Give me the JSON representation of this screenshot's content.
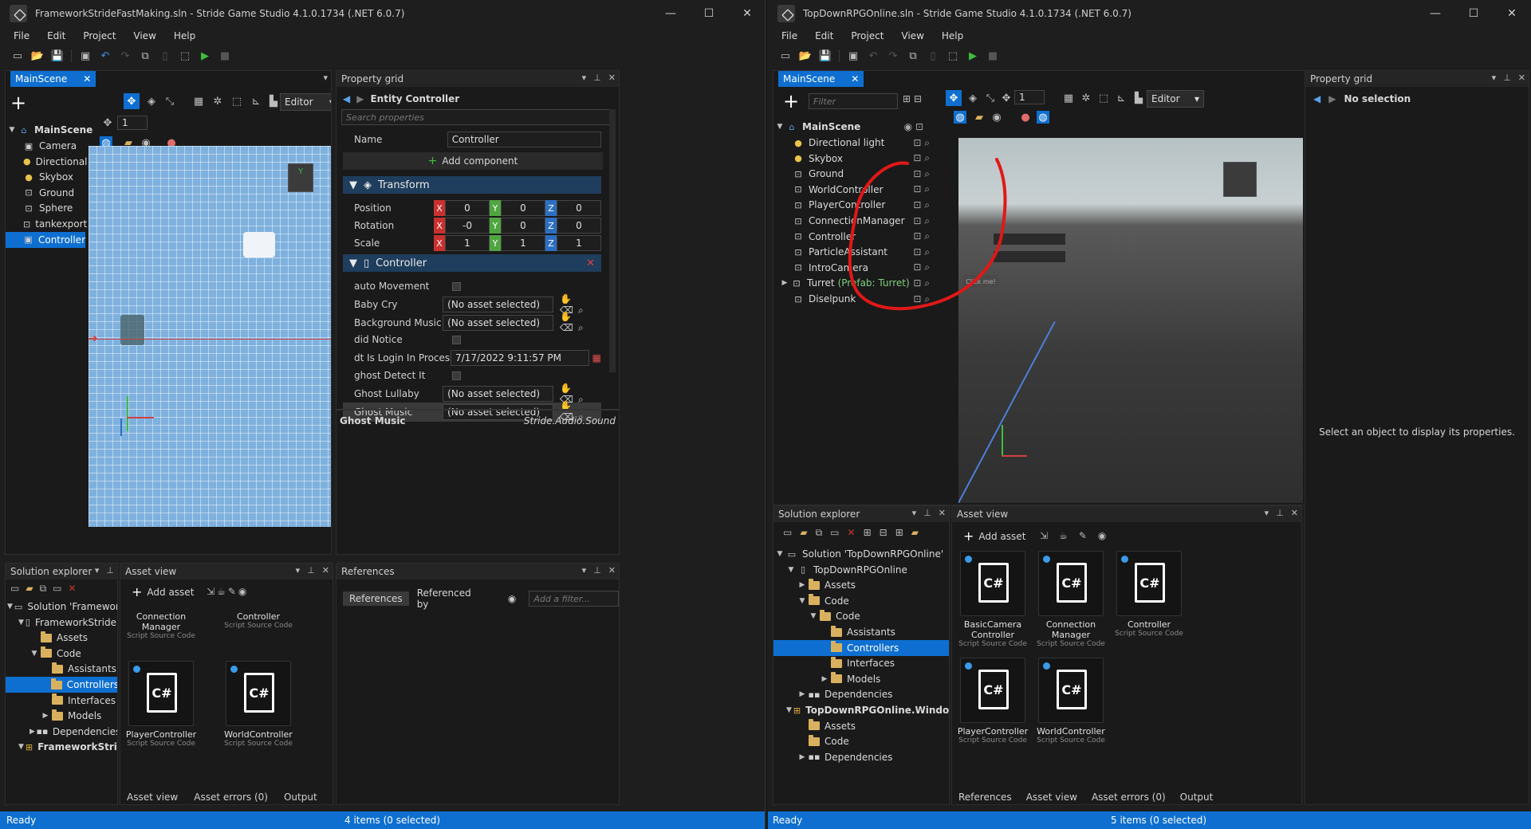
{
  "left": {
    "title": "FrameworkStrideFastMaking.sln - Stride Game Studio 4.1.0.1734 (.NET 6.0.7)",
    "menu": [
      "File",
      "Edit",
      "Project",
      "View",
      "Help"
    ],
    "scene_tab": "MainScene",
    "scene_editor_mode": "Editor",
    "snap_value": "1",
    "scene_tree": {
      "root": "MainScene",
      "items": [
        "Camera",
        "Directional light",
        "Skybox",
        "Ground",
        "Sphere",
        "tankexport",
        "Controller"
      ]
    },
    "property_grid": {
      "title": "Property grid",
      "entity_label": "Entity",
      "entity_name": "Controller",
      "search_placeholder": "Search properties",
      "name_label": "Name",
      "name_value": "Controller",
      "add_component": "Add component",
      "transform_section": "Transform",
      "position_label": "Position",
      "rotation_label": "Rotation",
      "scale_label": "Scale",
      "position": [
        "0",
        "0",
        "0"
      ],
      "rotation": [
        "-0",
        "0",
        "0"
      ],
      "scale": [
        "1",
        "1",
        "1"
      ],
      "axis_labels": [
        "X",
        "Y",
        "Z"
      ],
      "controller_section": "Controller",
      "props": [
        {
          "label": "auto Movement",
          "kind": "check"
        },
        {
          "label": "Baby Cry",
          "kind": "asset",
          "value": "(No asset selected)"
        },
        {
          "label": "Background Music",
          "kind": "asset",
          "value": "(No asset selected)"
        },
        {
          "label": "did Notice",
          "kind": "check"
        },
        {
          "label": "dt Is Login In Process",
          "kind": "date",
          "value": "7/17/2022 9:11:57 PM"
        },
        {
          "label": "ghost Detect It",
          "kind": "check"
        },
        {
          "label": "Ghost Lullaby",
          "kind": "asset",
          "value": "(No asset selected)"
        },
        {
          "label": "Ghost Music",
          "kind": "asset",
          "value": "(No asset selected)"
        }
      ],
      "footer_name": "Ghost Music",
      "footer_type": "Stride.Audio.Sound"
    },
    "solution_explorer": {
      "title": "Solution explorer",
      "items": [
        {
          "label": "Solution 'FrameworkStride",
          "indent": 0,
          "icon": "solution",
          "arrow": "▼"
        },
        {
          "label": "FrameworkStrideFas",
          "indent": 1,
          "icon": "project",
          "arrow": "▼"
        },
        {
          "label": "Assets",
          "indent": 2,
          "icon": "folder",
          "arrow": ""
        },
        {
          "label": "Code",
          "indent": 2,
          "icon": "folder",
          "arrow": "▼"
        },
        {
          "label": "Assistants",
          "indent": 3,
          "icon": "folder",
          "arrow": ""
        },
        {
          "label": "Controllers",
          "indent": 3,
          "icon": "folder",
          "arrow": "",
          "selected": true
        },
        {
          "label": "Interfaces",
          "indent": 3,
          "icon": "folder",
          "arrow": ""
        },
        {
          "label": "Models",
          "indent": 3,
          "icon": "folder",
          "arrow": "▶"
        },
        {
          "label": "Dependencies",
          "indent": 2,
          "icon": "deps",
          "arrow": "▶"
        },
        {
          "label": "FrameworkStrideI",
          "indent": 1,
          "icon": "windows",
          "arrow": "▼",
          "bold": true
        }
      ]
    },
    "asset_view": {
      "title": "Asset view",
      "add_asset": "Add asset",
      "tiles": [
        {
          "name": "Connection Manager",
          "type": "Script Source Code"
        },
        {
          "name": "Controller",
          "type": "Script Source Code"
        },
        {
          "name": "PlayerController",
          "type": "Script Source Code"
        },
        {
          "name": "WorldController",
          "type": "Script Source Code"
        }
      ],
      "bottom_tabs": [
        "Asset view",
        "Asset errors (0)",
        "Output"
      ]
    },
    "references": {
      "title": "References",
      "tab_references": "References",
      "tab_referenced_by": "Referenced by",
      "filter_placeholder": "Add a filter..."
    },
    "status_left": "Ready",
    "status_center": "4 items (0 selected)"
  },
  "right": {
    "title": "TopDownRPGOnline.sln - Stride Game Studio 4.1.0.1734 (.NET 6.0.7)",
    "menu": [
      "File",
      "Edit",
      "Project",
      "View",
      "Help"
    ],
    "scene_tab": "MainScene",
    "filter_placeholder": "Filter",
    "scene_editor_mode": "Editor",
    "snap_value": "1",
    "scene_tree": {
      "root": "MainScene",
      "items": [
        {
          "label": "Directional light",
          "icon": "light"
        },
        {
          "label": "Skybox",
          "icon": "light"
        },
        {
          "label": "Ground",
          "icon": "entity"
        },
        {
          "label": "WorldController",
          "icon": "entity"
        },
        {
          "label": "PlayerController",
          "icon": "entity"
        },
        {
          "label": "ConnectionManager",
          "icon": "entity"
        },
        {
          "label": "Controller",
          "icon": "entity"
        },
        {
          "label": "ParticleAssistant",
          "icon": "entity"
        },
        {
          "label": "IntroCamera",
          "icon": "entity"
        },
        {
          "label": "Turret",
          "icon": "entity",
          "prefab": "(Prefab: Turret)",
          "arrow": "▶"
        },
        {
          "label": "Diselpunk",
          "icon": "entity"
        }
      ]
    },
    "viewport_ui": {
      "button_label": "Click me!"
    },
    "property_grid": {
      "title": "Property grid",
      "no_selection": "No selection",
      "hint": "Select an object to display its properties."
    },
    "solution_explorer": {
      "title": "Solution explorer",
      "items": [
        {
          "label": "Solution 'TopDownRPGOnline'",
          "indent": 0,
          "icon": "solution",
          "arrow": "▼"
        },
        {
          "label": "TopDownRPGOnline",
          "indent": 1,
          "icon": "project",
          "arrow": "▼"
        },
        {
          "label": "Assets",
          "indent": 2,
          "icon": "folder",
          "arrow": "▶"
        },
        {
          "label": "Code",
          "indent": 2,
          "icon": "folder",
          "arrow": "▼"
        },
        {
          "label": "Code",
          "indent": 3,
          "icon": "folder",
          "arrow": "▼"
        },
        {
          "label": "Assistants",
          "indent": 4,
          "icon": "folder",
          "arrow": ""
        },
        {
          "label": "Controllers",
          "indent": 4,
          "icon": "folder",
          "arrow": "",
          "selected": true
        },
        {
          "label": "Interfaces",
          "indent": 4,
          "icon": "folder",
          "arrow": ""
        },
        {
          "label": "Models",
          "indent": 4,
          "icon": "folder",
          "arrow": "▶"
        },
        {
          "label": "Dependencies",
          "indent": 2,
          "icon": "deps",
          "arrow": "▶"
        },
        {
          "label": "TopDownRPGOnline.Windows",
          "indent": 1,
          "icon": "windows",
          "arrow": "▼",
          "bold": true
        },
        {
          "label": "Assets",
          "indent": 2,
          "icon": "folder",
          "arrow": ""
        },
        {
          "label": "Code",
          "indent": 2,
          "icon": "folder",
          "arrow": ""
        },
        {
          "label": "Dependencies",
          "indent": 2,
          "icon": "deps",
          "arrow": "▶"
        }
      ]
    },
    "asset_view": {
      "title": "Asset view",
      "add_asset": "Add asset",
      "tiles": [
        {
          "name": "BasicCamera Controller",
          "type": "Script Source Code"
        },
        {
          "name": "Connection Manager",
          "type": "Script Source Code"
        },
        {
          "name": "Controller",
          "type": "Script Source Code"
        },
        {
          "name": "PlayerController",
          "type": "Script Source Code"
        },
        {
          "name": "WorldController",
          "type": "Script Source Code"
        }
      ],
      "bottom_tabs": [
        "References",
        "Asset view",
        "Asset errors (0)",
        "Output"
      ]
    },
    "status_left": "Ready",
    "status_center": "5 items (0 selected)"
  },
  "colors": {
    "accent": "#0e6fd1",
    "annotation": "#e01818"
  }
}
